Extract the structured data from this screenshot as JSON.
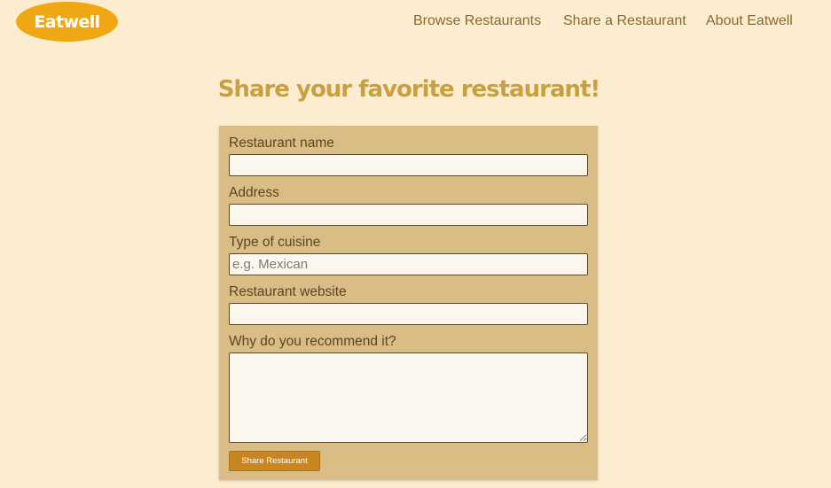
{
  "header": {
    "logo_text": "Eatwell",
    "nav": [
      {
        "label": "Browse Restaurants"
      },
      {
        "label": "Share a Restaurant"
      },
      {
        "label": "About Eatwell"
      }
    ]
  },
  "main": {
    "title": "Share your favorite restaurant!",
    "form": {
      "fields": [
        {
          "label": "Restaurant name",
          "value": "",
          "placeholder": ""
        },
        {
          "label": "Address",
          "value": "",
          "placeholder": ""
        },
        {
          "label": "Type of cuisine",
          "value": "",
          "placeholder": "e.g. Mexican"
        },
        {
          "label": "Restaurant website",
          "value": "",
          "placeholder": ""
        },
        {
          "label": "Why do you recommend it?",
          "value": "",
          "placeholder": ""
        }
      ],
      "submit_label": "Share Restaurant"
    }
  },
  "colors": {
    "background": "#fcecd0",
    "logo": "#f0a714",
    "title": "#c9a040",
    "form_card": "#d9bd84",
    "button": "#c98620"
  }
}
